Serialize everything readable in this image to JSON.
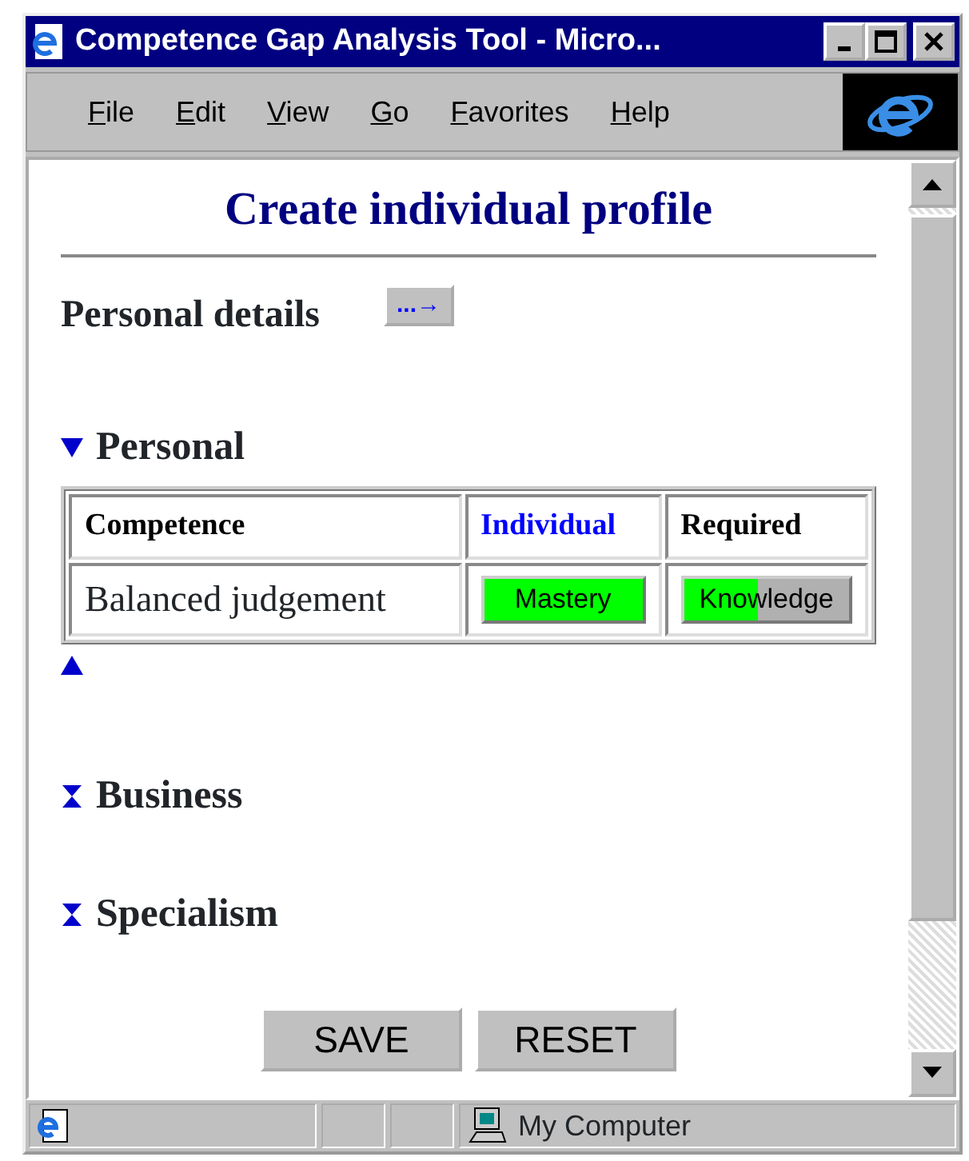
{
  "window": {
    "title": "Competence Gap Analysis Tool - Micro..."
  },
  "menu": [
    "File",
    "Edit",
    "View",
    "Go",
    "Favorites",
    "Help"
  ],
  "page": {
    "heading": "Create individual profile",
    "details_label": "Personal details",
    "details_button": "...→"
  },
  "sections": [
    {
      "title": "Personal",
      "expanded": true,
      "table": {
        "columns": [
          {
            "label": "Competence",
            "highlighted": false
          },
          {
            "label": "Individual",
            "highlighted": true
          },
          {
            "label": "Required",
            "highlighted": false
          }
        ],
        "rows": [
          {
            "competence": "Balanced judgement",
            "individual": {
              "label": "Mastery",
              "level": 1
            },
            "required": {
              "label": "Knowledge",
              "level": 0.45
            }
          }
        ]
      }
    },
    {
      "title": "Business",
      "expanded": false
    },
    {
      "title": "Specialism",
      "expanded": false
    }
  ],
  "buttons": [
    "SAVE",
    "RESET"
  ],
  "status_bar": {
    "zone": "My Computer"
  }
}
